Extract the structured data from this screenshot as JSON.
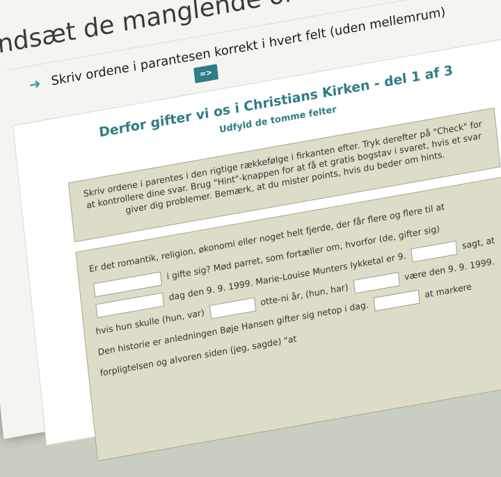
{
  "page": {
    "title": "Indsæt de manglende ord i hvert felt (udeladt)"
  },
  "instruction": {
    "icon": "arrow-right-icon",
    "text": "Skriv ordene i parantesen korrekt i hvert felt (uden mellemrum)"
  },
  "toolbar": {
    "go_label": "=>"
  },
  "exercise": {
    "title": "Derfor gifter vi os i Christians Kirken - del 1 af 3",
    "subtitle": "Udfyld de tomme felter",
    "help": "Skriv ordene i parentes i den rigtige rækkefølge i firkanten efter. Tryk derefter på \"Check\" for at kontrollere dine svar. Brug \"Hint\"-knappen for at få et gratis bogstav i svaret, hvis et svar giver dig problemer. Bemærk, at du mister points, hvis du beder om hints.",
    "text": {
      "seg1": "Er det romantik, religion, økonomi eller noget helt fjerde, der får flere og flere til at",
      "seg2": "i",
      "seg3": "gifte sig? Mød parret, som fortæller om, hvorfor (de, gifter sig)",
      "seg4": "dag den 9. 9. 1999. Marie-Louise Munters lykketal er 9.",
      "seg5": "sagt, at hvis hun skulle",
      "seg6": "(hun, var)",
      "seg7": "otte-ni år, (hun, har)",
      "seg8": "være den 9. 9. 1999. Den historie er anledningen",
      "seg9": "Bøje Hansen gifter sig netop i dag.",
      "seg10": "at markere forpligtelsen og alvoren",
      "seg11": "siden (jeg, sagde)",
      "seg12": "\"at"
    }
  },
  "colors": {
    "accent": "#2f7d86",
    "panel": "#dcdcc8"
  }
}
